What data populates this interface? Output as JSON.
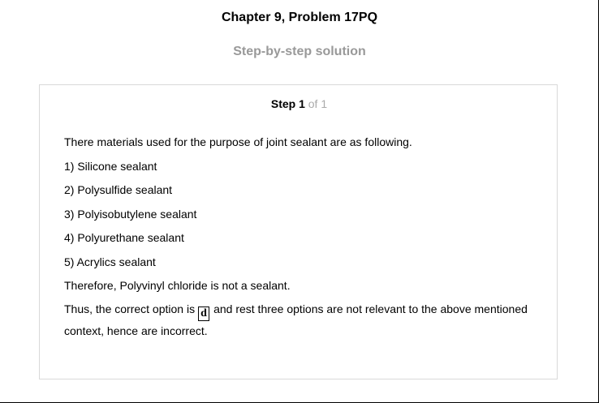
{
  "header": {
    "title": "Chapter 9, Problem 17PQ",
    "subtitle": "Step-by-step solution"
  },
  "step": {
    "label": "Step 1",
    "of": "of 1"
  },
  "solution": {
    "intro": "There materials used for the purpose of joint sealant are as following.",
    "items": [
      "1) Silicone sealant",
      "2) Polysulfide sealant",
      "3) Polyisobutylene sealant",
      "4) Polyurethane sealant",
      "5) Acrylics sealant"
    ],
    "therefore": "Therefore, Polyvinyl chloride is not a sealant.",
    "conclusion_before": "Thus, the correct option is",
    "answer": "d",
    "conclusion_after": "and rest three options are not relevant to the above mentioned context, hence are incorrect."
  }
}
